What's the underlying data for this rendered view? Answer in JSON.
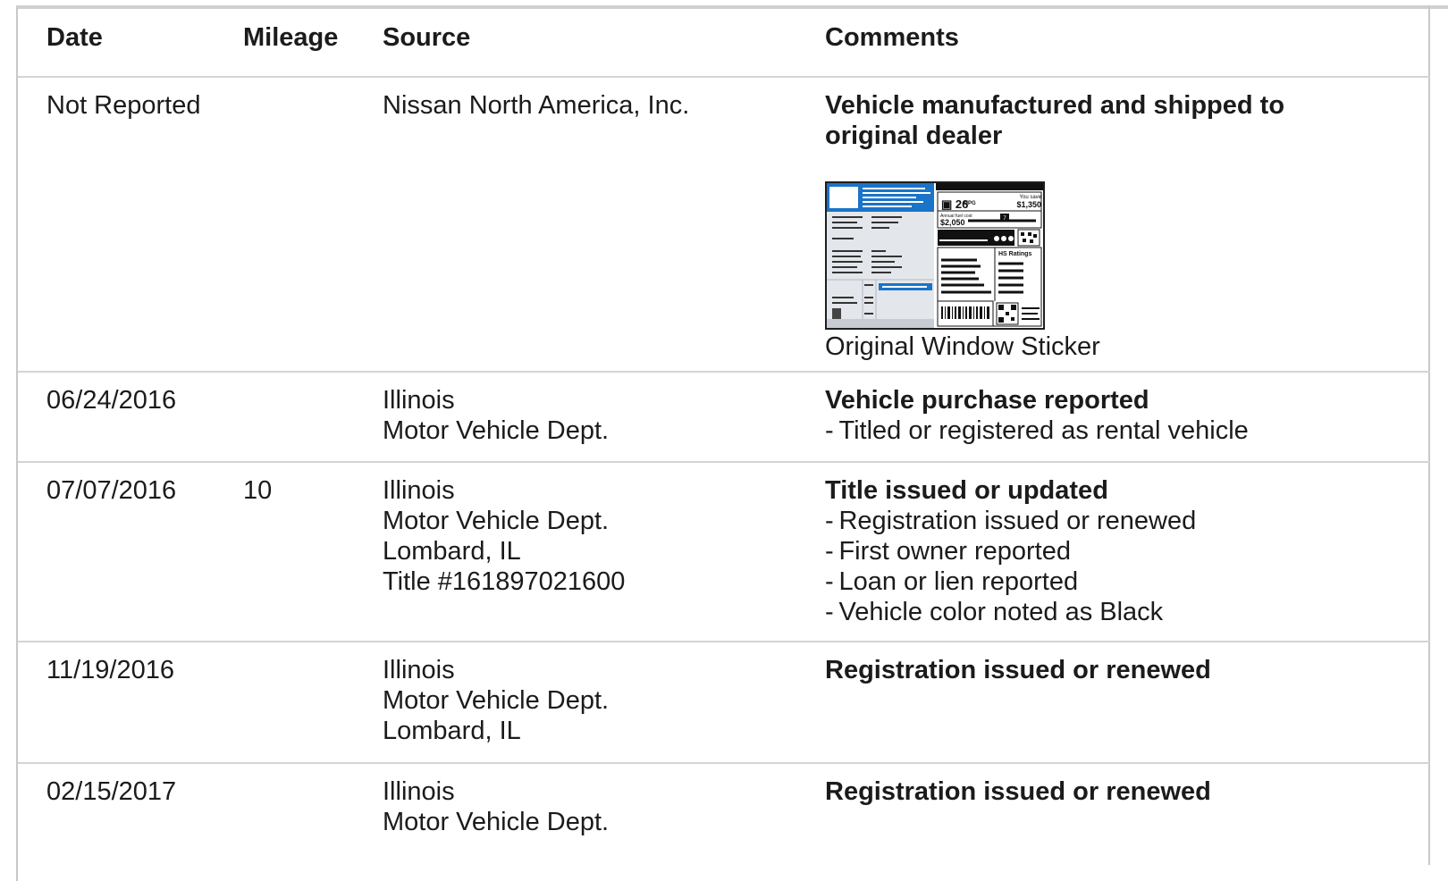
{
  "header": {
    "date": "Date",
    "mileage": "Mileage",
    "source": "Source",
    "comments": "Comments"
  },
  "rows": [
    {
      "date": "Not Reported",
      "mileage": "",
      "source": [
        "Nissan North America, Inc."
      ],
      "comment_title": "Vehicle manufactured and shipped to original dealer",
      "comment_items": [],
      "sticker": {
        "caption": "Original Window Sticker",
        "mpg": "26",
        "mpg_unit": "MPG",
        "save_label": "You save",
        "save_value": "$1,350",
        "cost_label": "Annual fuel cost",
        "cost_value": "$2,050",
        "ratings_label": "HS Ratings",
        "scale_value": "7"
      }
    },
    {
      "date": "06/24/2016",
      "mileage": "",
      "source": [
        "Illinois",
        "Motor Vehicle Dept."
      ],
      "comment_title": "Vehicle purchase reported",
      "comment_items": [
        "Titled or registered as rental vehicle"
      ]
    },
    {
      "date": "07/07/2016",
      "mileage": "10",
      "source": [
        "Illinois",
        "Motor Vehicle Dept.",
        "Lombard, IL",
        "Title #161897021600"
      ],
      "comment_title": "Title issued or updated",
      "comment_items": [
        "Registration issued or renewed",
        "First owner reported",
        "Loan or lien reported",
        "Vehicle color noted as Black"
      ]
    },
    {
      "date": "11/19/2016",
      "mileage": "",
      "source": [
        "Illinois",
        "Motor Vehicle Dept.",
        "Lombard, IL"
      ],
      "comment_title": "Registration issued or renewed",
      "comment_items": []
    },
    {
      "date": "02/15/2017",
      "mileage": "",
      "source": [
        "Illinois",
        "Motor Vehicle Dept."
      ],
      "comment_title": "Registration issued or renewed",
      "comment_items": []
    }
  ],
  "colors": {
    "sticker_blue": "#1a74c8",
    "sticker_panel": "#e3e6ea",
    "border": "#d4d4d4"
  }
}
